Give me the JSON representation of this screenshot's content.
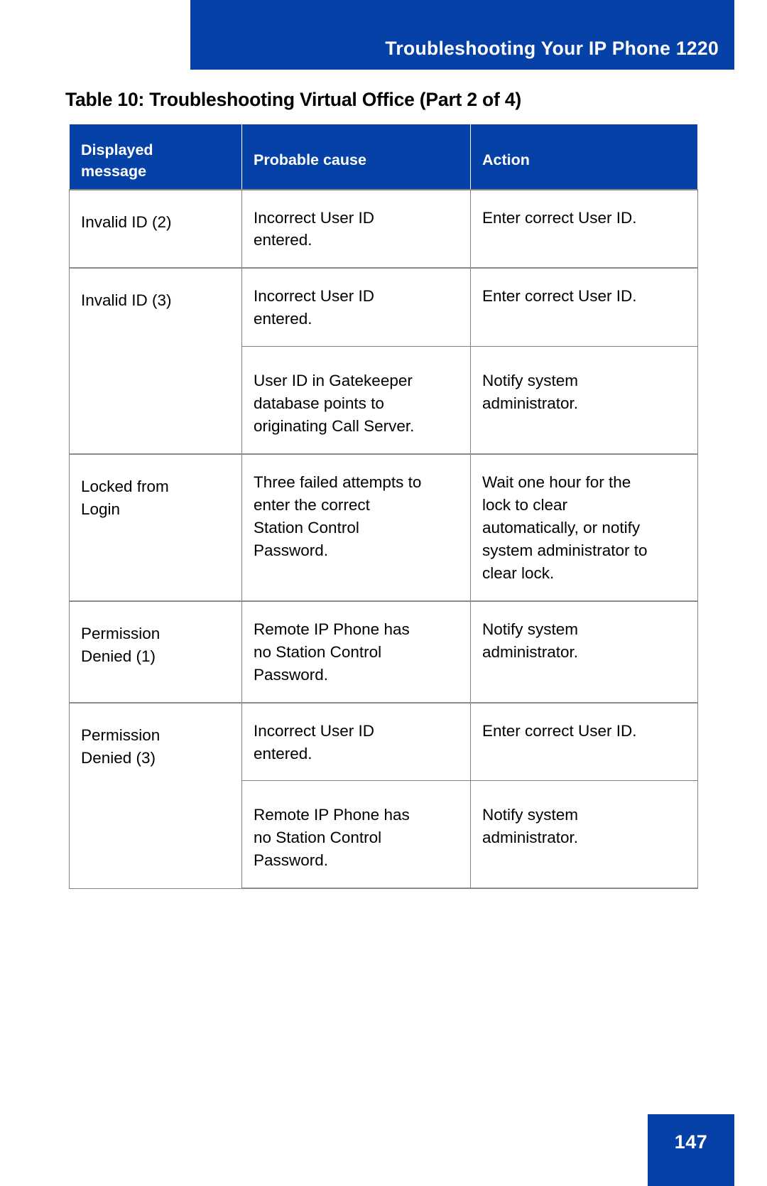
{
  "header": {
    "running_title": "Troubleshooting Your IP Phone 1220",
    "banner_color": "#0641a8"
  },
  "caption": {
    "text": "Table 10: Troubleshooting Virtual Office (Part 2 of 4)"
  },
  "table": {
    "columns": [
      {
        "label": "Displayed message",
        "line1": "Displayed",
        "line2": "message"
      },
      {
        "label": "Probable cause"
      },
      {
        "label": "Action"
      }
    ],
    "rows": [
      {
        "message": "Invalid ID (2)",
        "entries": [
          {
            "cause_line1": "Incorrect User ID",
            "cause_line2": "entered.",
            "action_line1": "Enter correct User ID.",
            "action_line2": ""
          }
        ]
      },
      {
        "message": "Invalid ID (3)",
        "entries": [
          {
            "cause_line1": "Incorrect User ID",
            "cause_line2": "entered.",
            "action_line1": "Enter correct User ID.",
            "action_line2": ""
          },
          {
            "cause_line1": "User ID in Gatekeeper",
            "cause_line2": "database points to",
            "cause_line3": "originating Call Server.",
            "action_line1": "Notify system",
            "action_line2": "administrator."
          }
        ]
      },
      {
        "message_line1": "Locked from",
        "message_line2": "Login",
        "entries": [
          {
            "cause_line1": "Three failed attempts to",
            "cause_line2": "enter the correct",
            "cause_line3": "Station Control",
            "cause_line4": "Password.",
            "action_line1": "Wait one hour for the",
            "action_line2": "lock to clear",
            "action_line3": "automatically, or notify",
            "action_line4": "system administrator to",
            "action_line5": "clear lock."
          }
        ]
      },
      {
        "message_line1": "Permission",
        "message_line2": "Denied (1)",
        "entries": [
          {
            "cause_line1": "Remote IP Phone has",
            "cause_line2": "no Station Control",
            "cause_line3": "Password.",
            "action_line1": "Notify system",
            "action_line2": "administrator."
          }
        ]
      },
      {
        "message_line1": "Permission",
        "message_line2": "Denied (3)",
        "entries": [
          {
            "cause_line1": "Incorrect User ID",
            "cause_line2": "entered.",
            "action_line1": "Enter correct User ID.",
            "action_line2": ""
          },
          {
            "cause_line1": "Remote IP Phone has",
            "cause_line2": "no Station Control",
            "cause_line3": "Password.",
            "action_line1": "Notify system",
            "action_line2": "administrator."
          }
        ]
      }
    ]
  },
  "footer": {
    "page_number": "147",
    "block_color": "#0641a8"
  }
}
